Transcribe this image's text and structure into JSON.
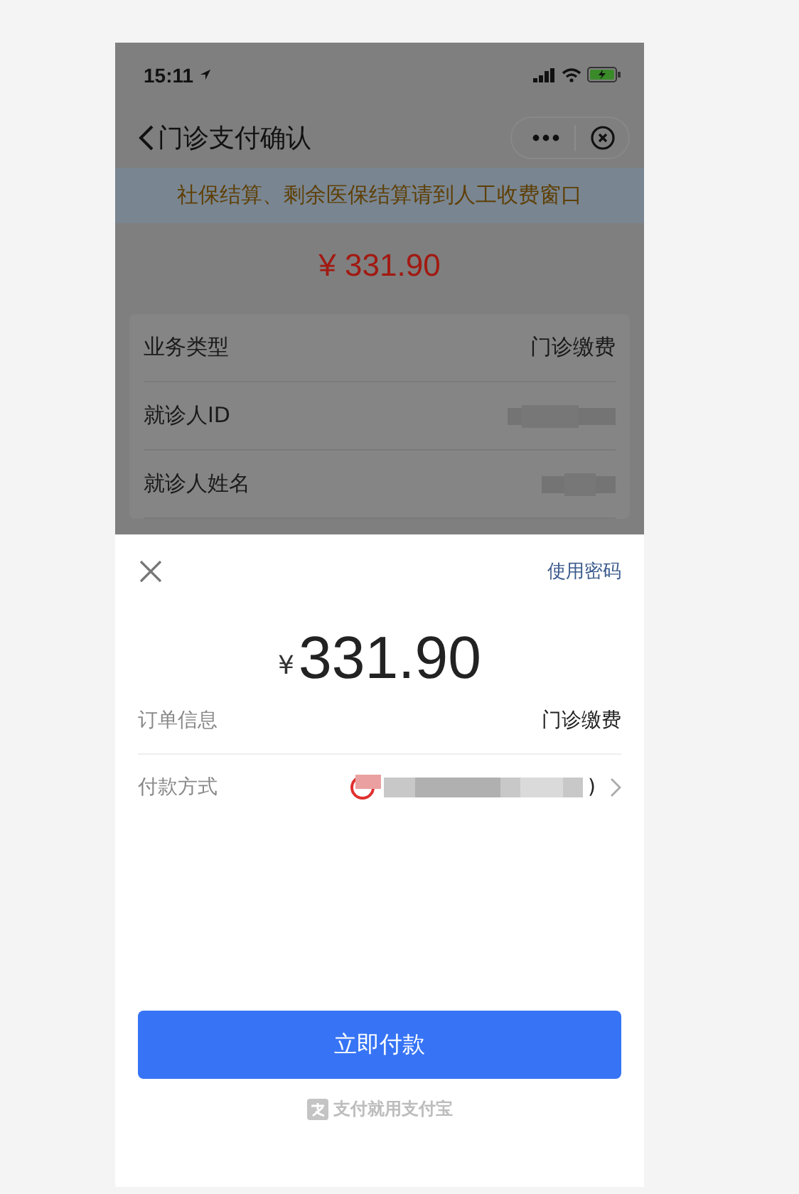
{
  "status_bar": {
    "time": "15:11"
  },
  "nav_bar": {
    "title": "门诊支付确认"
  },
  "notice": "社保结算、剩余医保结算请到人工收费窗口",
  "amount": "¥ 331.90",
  "details": [
    {
      "label": "业务类型",
      "value": "门诊缴费",
      "redacted": false
    },
    {
      "label": "就诊人ID",
      "redacted": true
    },
    {
      "label": "就诊人姓名",
      "redacted": true
    }
  ],
  "payment_sheet": {
    "link": "使用密码",
    "currency": "¥",
    "amount": "331.90",
    "rows": [
      {
        "kind": "text",
        "label": "订单信息",
        "value": "门诊缴费"
      },
      {
        "kind": "method",
        "label": "付款方式",
        "value": ")"
      }
    ],
    "button": "立即付款",
    "footer": "支付就用支付宝"
  }
}
